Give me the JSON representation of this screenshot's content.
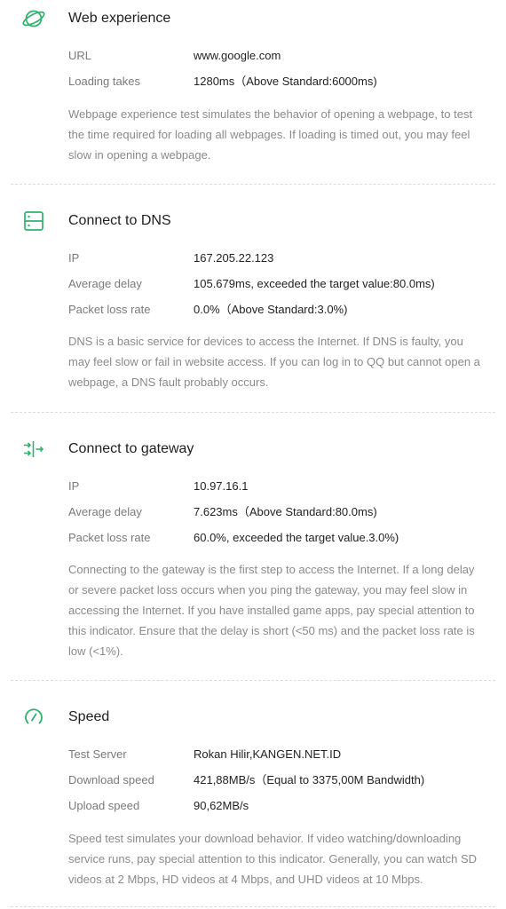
{
  "accent_color": "#2db36b",
  "sections": [
    {
      "icon": "globe-icon",
      "title": "Web experience",
      "rows": [
        {
          "label": "URL",
          "value": "www.google.com"
        },
        {
          "label": "Loading takes",
          "value": "1280ms（Above Standard:6000ms)"
        }
      ],
      "description": "Webpage experience test simulates the behavior of opening a webpage, to test the time required for loading all webpages. If loading is timed out, you may feel slow in opening a webpage."
    },
    {
      "icon": "server-icon",
      "title": "Connect to DNS",
      "rows": [
        {
          "label": "IP",
          "value": "167.205.22.123"
        },
        {
          "label": "Average delay",
          "value": "105.679ms, exceeded the target value:80.0ms)"
        },
        {
          "label": "Packet loss rate",
          "value": "0.0%（Above Standard:3.0%)"
        }
      ],
      "description": "DNS is a basic service for devices to access the Internet. If DNS is faulty, you may feel slow or fail in website access. If you can log in to QQ but cannot open a webpage, a DNS fault probably occurs."
    },
    {
      "icon": "gateway-icon",
      "title": "Connect to gateway",
      "rows": [
        {
          "label": "IP",
          "value": "10.97.16.1"
        },
        {
          "label": "Average delay",
          "value": "7.623ms（Above Standard:80.0ms)"
        },
        {
          "label": "Packet loss rate",
          "value": "60.0%, exceeded the target value.3.0%)"
        }
      ],
      "description": "Connecting to the gateway is the first step to access the Internet. If a long delay or severe packet loss occurs when you ping the gateway, you may feel slow in accessing the Internet. If you have installed game apps, pay special attention to this indicator. Ensure that the delay is short (<50 ms) and the packet loss rate is low (<1%)."
    },
    {
      "icon": "speedometer-icon",
      "title": "Speed",
      "rows": [
        {
          "label": "Test Server",
          "value": "Rokan Hilir,KANGEN.NET.ID"
        },
        {
          "label": "Download speed",
          "value": "421,88MB/s（Equal to 3375,00M Bandwidth)"
        },
        {
          "label": "Upload speed",
          "value": "90,62MB/s"
        }
      ],
      "description": "Speed test simulates your download behavior. If video watching/downloading service runs, pay special attention to this indicator. Generally, you can watch SD videos at 2 Mbps, HD videos at 4 Mbps, and UHD videos at 10 Mbps."
    }
  ]
}
